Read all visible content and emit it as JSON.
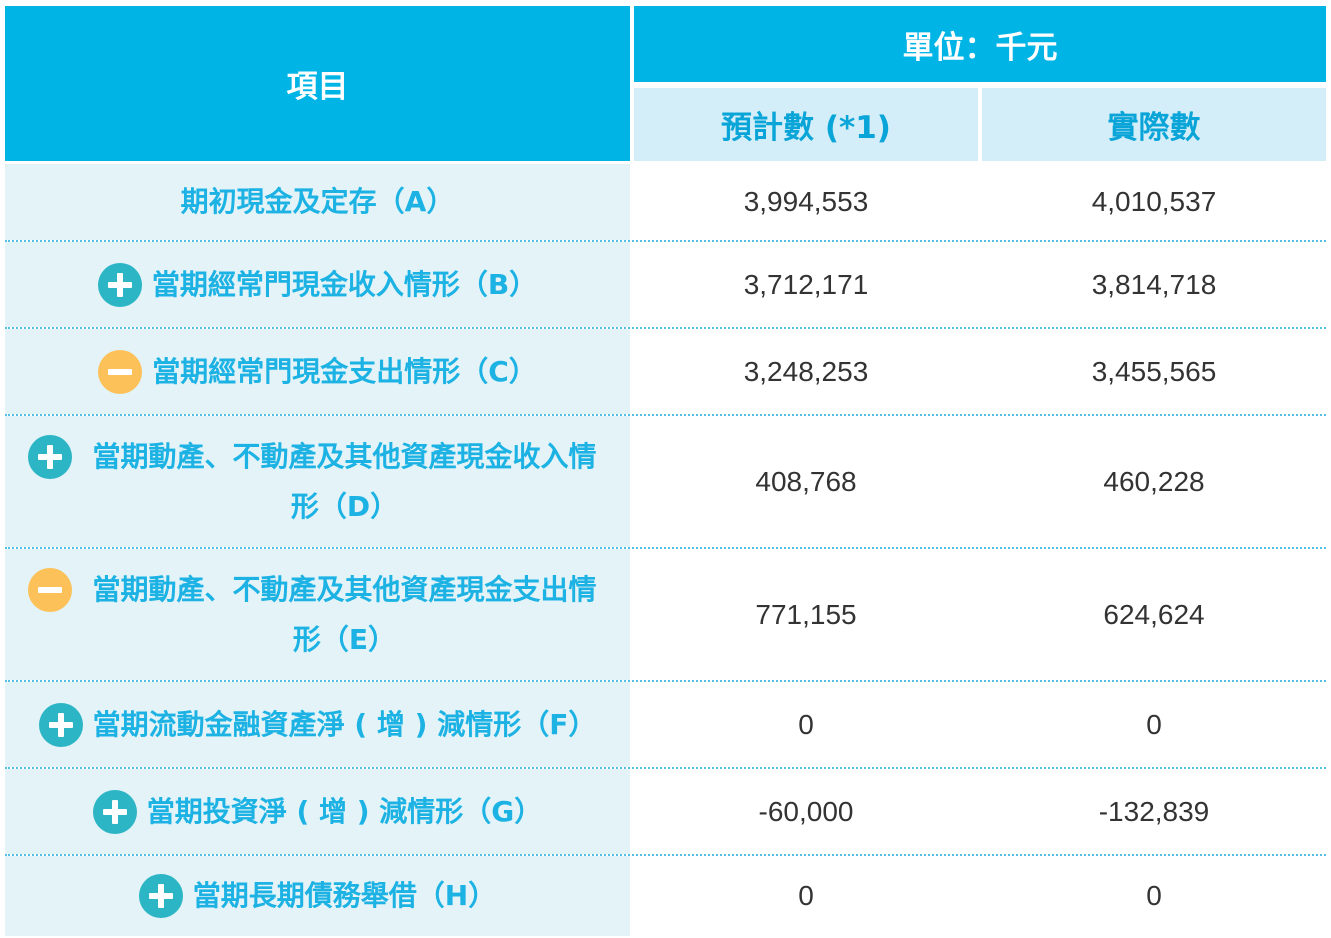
{
  "header": {
    "item": "項目",
    "unit": "單位：千元",
    "estimated": "預計數 (*1)",
    "actual": "實際數"
  },
  "rows": [
    {
      "icon": "none",
      "label": "期初現金及定存（A）",
      "estimated": "3,994,553",
      "actual": "4,010,537"
    },
    {
      "icon": "plus",
      "label": "當期經常門現金收入情形（B）",
      "estimated": "3,712,171",
      "actual": "3,814,718"
    },
    {
      "icon": "minus",
      "label": "當期經常門現金支出情形（C）",
      "estimated": "3,248,253",
      "actual": "3,455,565"
    },
    {
      "icon": "plus",
      "label": "當期動產、不動產及其他資產現金收入情形（D）",
      "estimated": "408,768",
      "actual": "460,228"
    },
    {
      "icon": "minus",
      "label": "當期動產、不動產及其他資產現金支出情形（E）",
      "estimated": "771,155",
      "actual": "624,624"
    },
    {
      "icon": "plus",
      "label": "當期流動金融資產淨 ( 增 ) 減情形（F）",
      "estimated": "0",
      "actual": "0"
    },
    {
      "icon": "plus",
      "label": "當期投資淨 ( 增 ) 減情形（G）",
      "estimated": "-60,000",
      "actual": "-132,839"
    },
    {
      "icon": "plus",
      "label": "當期長期債務舉借（H）",
      "estimated": "0",
      "actual": "0"
    }
  ],
  "colors": {
    "header_bg": "#00b4e6",
    "subheader_bg": "#d4eef9",
    "label_bg": "#e3f3f8",
    "label_text": "#1cb2e3",
    "plus_icon": "#2bb5c5",
    "minus_icon": "#fcc159"
  }
}
